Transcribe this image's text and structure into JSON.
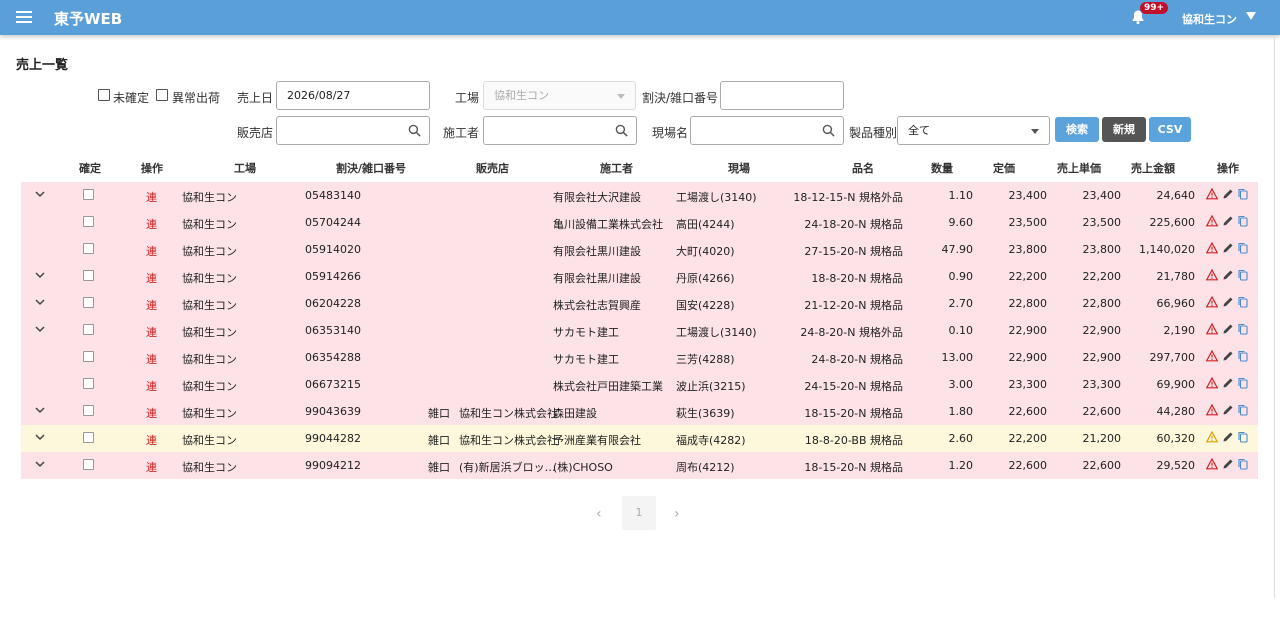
{
  "header": {
    "app_title": "東予WEB",
    "notification_count": "99+",
    "user_name": "協和生コン"
  },
  "page": {
    "title": "売上一覧"
  },
  "filters": {
    "unconfirmed_label": "未確定",
    "abnormal_label": "異常出荷",
    "sales_date_label": "売上日",
    "sales_date_value": "2026/08/27",
    "factory_label": "工場",
    "factory_value": "協和生コン",
    "invoice_label": "割決/雑口番号",
    "store_label": "販売店",
    "contractor_label": "施工者",
    "site_label": "現場名",
    "product_type_label": "製品種別",
    "product_type_value": "全て",
    "search_button": "検索",
    "new_button": "新規",
    "csv_button": "CSV"
  },
  "table": {
    "columns": [
      "確定",
      "操作",
      "工場",
      "割決/雑口番号",
      "販売店",
      "施工者",
      "現場",
      "品名",
      "数量",
      "定価",
      "売上単価",
      "売上金額",
      "操作"
    ],
    "rows": [
      {
        "status": "pink",
        "expand": true,
        "op": "連",
        "factory": "協和生コン",
        "number": "05483140",
        "misc": "",
        "store": "",
        "contractor": "有限会社大沢建設",
        "site": "工場渡し(3140)",
        "product": "18-12-15-N 規格外品",
        "qty": "1.10",
        "list_price": "23,400",
        "unit_price": "23,400",
        "amount": "24,640",
        "warn": "red"
      },
      {
        "status": "pink",
        "expand": false,
        "op": "連",
        "factory": "協和生コン",
        "number": "05704244",
        "misc": "",
        "store": "",
        "contractor": "亀川設備工業株式会社",
        "site": "高田(4244)",
        "product": "24-18-20-N 規格品",
        "qty": "9.60",
        "list_price": "23,500",
        "unit_price": "23,500",
        "amount": "225,600",
        "warn": "red"
      },
      {
        "status": "pink",
        "expand": false,
        "op": "連",
        "factory": "協和生コン",
        "number": "05914020",
        "misc": "",
        "store": "",
        "contractor": "有限会社黒川建設",
        "site": "大町(4020)",
        "product": "27-15-20-N 規格品",
        "qty": "47.90",
        "list_price": "23,800",
        "unit_price": "23,800",
        "amount": "1,140,020",
        "warn": "red"
      },
      {
        "status": "pink",
        "expand": true,
        "op": "連",
        "factory": "協和生コン",
        "number": "05914266",
        "misc": "",
        "store": "",
        "contractor": "有限会社黒川建設",
        "site": "丹原(4266)",
        "product": "18-8-20-N 規格品",
        "qty": "0.90",
        "list_price": "22,200",
        "unit_price": "22,200",
        "amount": "21,780",
        "warn": "red"
      },
      {
        "status": "pink",
        "expand": true,
        "op": "連",
        "factory": "協和生コン",
        "number": "06204228",
        "misc": "",
        "store": "",
        "contractor": "株式会社志賀興産",
        "site": "国安(4228)",
        "product": "21-12-20-N 規格品",
        "qty": "2.70",
        "list_price": "22,800",
        "unit_price": "22,800",
        "amount": "66,960",
        "warn": "red"
      },
      {
        "status": "pink",
        "expand": true,
        "op": "連",
        "factory": "協和生コン",
        "number": "06353140",
        "misc": "",
        "store": "",
        "contractor": "サカモト建工",
        "site": "工場渡し(3140)",
        "product": "24-8-20-N 規格外品",
        "qty": "0.10",
        "list_price": "22,900",
        "unit_price": "22,900",
        "amount": "2,190",
        "warn": "red"
      },
      {
        "status": "pink",
        "expand": false,
        "op": "連",
        "factory": "協和生コン",
        "number": "06354288",
        "misc": "",
        "store": "",
        "contractor": "サカモト建工",
        "site": "三芳(4288)",
        "product": "24-8-20-N 規格品",
        "qty": "13.00",
        "list_price": "22,900",
        "unit_price": "22,900",
        "amount": "297,700",
        "warn": "red"
      },
      {
        "status": "pink",
        "expand": false,
        "op": "連",
        "factory": "協和生コン",
        "number": "06673215",
        "misc": "",
        "store": "",
        "contractor": "株式会社戸田建築工業",
        "site": "波止浜(3215)",
        "product": "24-15-20-N 規格品",
        "qty": "3.00",
        "list_price": "23,300",
        "unit_price": "23,300",
        "amount": "69,900",
        "warn": "red"
      },
      {
        "status": "pink",
        "expand": true,
        "op": "連",
        "factory": "協和生コン",
        "number": "99043639",
        "misc": "雑口",
        "store": "協和生コン株式会社",
        "contractor": "森田建設",
        "site": "萩生(3639)",
        "product": "18-15-20-N 規格品",
        "qty": "1.80",
        "list_price": "22,600",
        "unit_price": "22,600",
        "amount": "44,280",
        "warn": "red"
      },
      {
        "status": "yellow",
        "expand": true,
        "op": "連",
        "factory": "協和生コン",
        "number": "99044282",
        "misc": "雑口",
        "store": "協和生コン株式会社",
        "contractor": "予洲産業有限会社",
        "site": "福成寺(4282)",
        "product": "18-8-20-BB 規格品",
        "qty": "2.60",
        "list_price": "22,200",
        "unit_price": "21,200",
        "amount": "60,320",
        "warn": "yellow"
      },
      {
        "status": "pink",
        "expand": true,
        "op": "連",
        "factory": "協和生コン",
        "number": "99094212",
        "misc": "雑口",
        "store": "(有)新居浜ブロッ…",
        "contractor": "(株)CHOSO",
        "site": "周布(4212)",
        "product": "18-15-20-N 規格品",
        "qty": "1.20",
        "list_price": "22,600",
        "unit_price": "22,600",
        "amount": "29,520",
        "warn": "red"
      }
    ]
  },
  "pagination": {
    "current": "1"
  },
  "colors": {
    "header_bg": "#5b9fd9",
    "row_pink": "#fde3e8",
    "row_yellow": "#fdf7dc",
    "warn_red": "#d02020",
    "warn_yellow": "#e0a000"
  }
}
